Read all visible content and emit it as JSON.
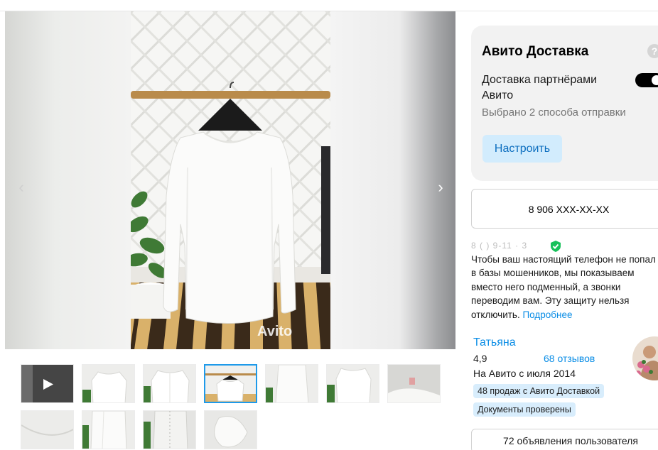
{
  "gallery": {
    "prev_arrow": "‹",
    "next_arrow": "›",
    "watermark": "Avito",
    "thumbnails": [
      {
        "kind": "video",
        "icon": "play-icon"
      },
      {
        "kind": "photo"
      },
      {
        "kind": "photo"
      },
      {
        "kind": "photo",
        "selected": true
      },
      {
        "kind": "photo"
      },
      {
        "kind": "photo"
      },
      {
        "kind": "photo"
      },
      {
        "kind": "photo"
      },
      {
        "kind": "photo"
      },
      {
        "kind": "photo"
      },
      {
        "kind": "photo"
      }
    ]
  },
  "delivery": {
    "title": "Авито Доставка",
    "help_icon": "?",
    "description": "Доставка партнёрами Авито",
    "toggle_on": true,
    "subtitle": "Выбрано 2 способа отправки",
    "setup_button": "Настроить"
  },
  "contact": {
    "phone_button": "8 906 XXX-XX-XX",
    "masked_number": "8 ( ) 9-11 · 3",
    "privacy_text": "Чтобы ваш настоящий телефон не попал в базы мошенников, мы показываем вместо него подменный, а звонки переводим вам. Эту защиту нельзя отключить.",
    "privacy_link": "Подробнее"
  },
  "seller": {
    "name": "Татьяна",
    "rating": "4,9",
    "reviews": "68 отзывов",
    "since": "На Авито с июля 2014",
    "badges": [
      "48 продаж с Авито Доставкой",
      "Документы проверены"
    ],
    "ads_button": "72 объявления пользователя"
  },
  "colors": {
    "accent": "#0a8de6",
    "setup_bg": "#d2ecfd",
    "badge_bg": "#d8edfc",
    "shield": "#17c15a"
  }
}
